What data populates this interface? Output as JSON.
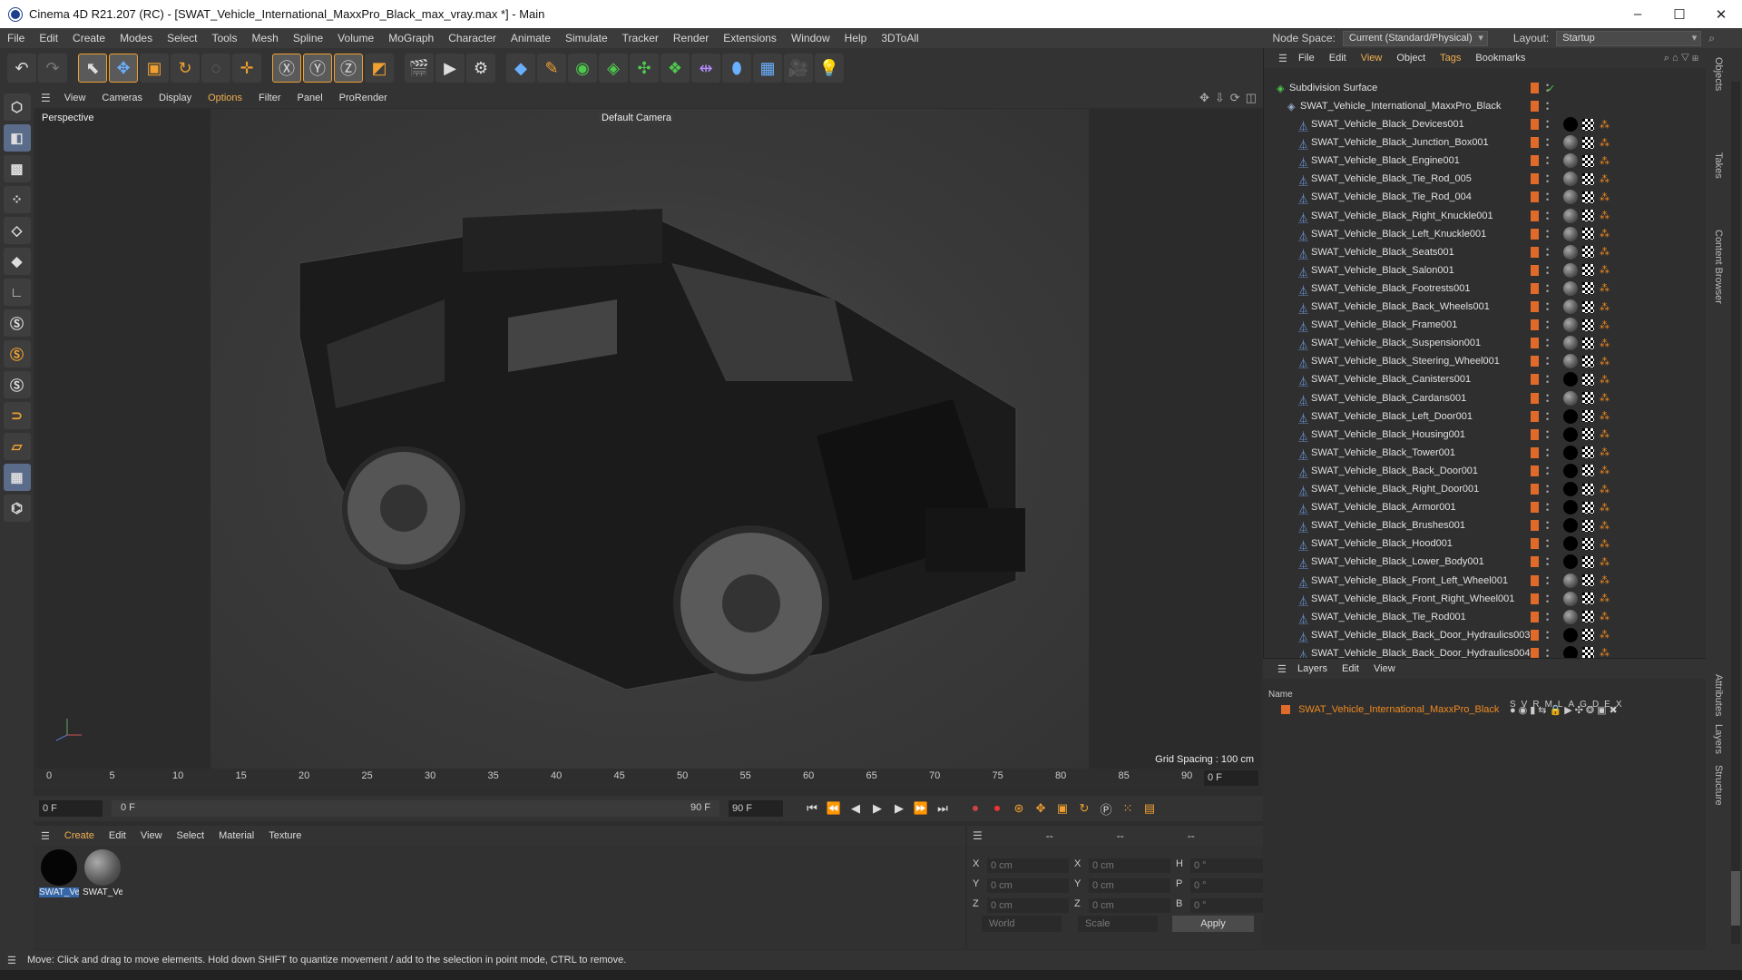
{
  "window": {
    "title": "Cinema 4D R21.207 (RC) - [SWAT_Vehicle_International_MaxxPro_Black_max_vray.max *] - Main",
    "min": "–",
    "max": "☐",
    "close": "✕"
  },
  "menu": [
    "File",
    "Edit",
    "Create",
    "Modes",
    "Select",
    "Tools",
    "Mesh",
    "Spline",
    "Volume",
    "MoGraph",
    "Character",
    "Animate",
    "Simulate",
    "Tracker",
    "Render",
    "Extensions",
    "Window",
    "Help",
    "3DToAll"
  ],
  "node_space": {
    "label": "Node Space:",
    "value": "Current (Standard/Physical)"
  },
  "layout": {
    "label": "Layout:",
    "value": "Startup"
  },
  "viewport": {
    "menu": [
      "View",
      "Cameras",
      "Display",
      "Options",
      "Filter",
      "Panel",
      "ProRender"
    ],
    "highlight_index": 3,
    "label": "Perspective",
    "camera": "Default Camera",
    "grid_spacing": "Grid Spacing : 100 cm"
  },
  "timeline": {
    "ticks": [
      "0",
      "5",
      "10",
      "15",
      "20",
      "25",
      "30",
      "35",
      "40",
      "45",
      "50",
      "55",
      "60",
      "65",
      "70",
      "75",
      "80",
      "85",
      "90"
    ],
    "current_frame": "0 F",
    "start": "0 F",
    "range_start": "0 F",
    "range_end": "90 F",
    "end": "90 F"
  },
  "materials": {
    "menu": [
      "Create",
      "Edit",
      "View",
      "Select",
      "Material",
      "Texture"
    ],
    "items": [
      {
        "label": "SWAT_Ve"
      },
      {
        "label": "SWAT_Ve"
      }
    ]
  },
  "coords": {
    "rows": [
      {
        "a": "X",
        "av": "0 cm",
        "b": "X",
        "bv": "0 cm",
        "c": "H",
        "cv": "0 °"
      },
      {
        "a": "Y",
        "av": "0 cm",
        "b": "Y",
        "bv": "0 cm",
        "c": "P",
        "cv": "0 °"
      },
      {
        "a": "Z",
        "av": "0 cm",
        "b": "Z",
        "bv": "0 cm",
        "c": "B",
        "cv": "0 °"
      }
    ],
    "world": "World",
    "scale": "Scale",
    "apply": "Apply",
    "dashes": [
      "--",
      "--",
      "--"
    ]
  },
  "status": "Move: Click and drag to move elements. Hold down SHIFT to quantize movement / add to the selection in point mode, CTRL to remove.",
  "objects": {
    "menu": [
      "File",
      "Edit",
      "View",
      "Object",
      "Tags",
      "Bookmarks"
    ],
    "root": "Subdivision Surface",
    "group": "SWAT_Vehicle_International_MaxxPro_Black",
    "items": [
      {
        "name": "SWAT_Vehicle_Black_Devices001",
        "black": true
      },
      {
        "name": "SWAT_Vehicle_Black_Junction_Box001",
        "black": false
      },
      {
        "name": "SWAT_Vehicle_Black_Engine001",
        "black": false
      },
      {
        "name": "SWAT_Vehicle_Black_Tie_Rod_005",
        "black": false
      },
      {
        "name": "SWAT_Vehicle_Black_Tie_Rod_004",
        "black": false
      },
      {
        "name": "SWAT_Vehicle_Black_Right_Knuckle001",
        "black": false
      },
      {
        "name": "SWAT_Vehicle_Black_Left_Knuckle001",
        "black": false
      },
      {
        "name": "SWAT_Vehicle_Black_Seats001",
        "black": false
      },
      {
        "name": "SWAT_Vehicle_Black_Salon001",
        "black": false
      },
      {
        "name": "SWAT_Vehicle_Black_Footrests001",
        "black": false
      },
      {
        "name": "SWAT_Vehicle_Black_Back_Wheels001",
        "black": false
      },
      {
        "name": "SWAT_Vehicle_Black_Frame001",
        "black": false
      },
      {
        "name": "SWAT_Vehicle_Black_Suspension001",
        "black": false
      },
      {
        "name": "SWAT_Vehicle_Black_Steering_Wheel001",
        "black": false
      },
      {
        "name": "SWAT_Vehicle_Black_Canisters001",
        "black": true
      },
      {
        "name": "SWAT_Vehicle_Black_Cardans001",
        "black": false
      },
      {
        "name": "SWAT_Vehicle_Black_Left_Door001",
        "black": true
      },
      {
        "name": "SWAT_Vehicle_Black_Housing001",
        "black": true
      },
      {
        "name": "SWAT_Vehicle_Black_Tower001",
        "black": true
      },
      {
        "name": "SWAT_Vehicle_Black_Back_Door001",
        "black": true
      },
      {
        "name": "SWAT_Vehicle_Black_Right_Door001",
        "black": true
      },
      {
        "name": "SWAT_Vehicle_Black_Armor001",
        "black": true
      },
      {
        "name": "SWAT_Vehicle_Black_Brushes001",
        "black": true
      },
      {
        "name": "SWAT_Vehicle_Black_Hood001",
        "black": true
      },
      {
        "name": "SWAT_Vehicle_Black_Lower_Body001",
        "black": true
      },
      {
        "name": "SWAT_Vehicle_Black_Front_Left_Wheel001",
        "black": false
      },
      {
        "name": "SWAT_Vehicle_Black_Front_Right_Wheel001",
        "black": false
      },
      {
        "name": "SWAT_Vehicle_Black_Tie_Rod001",
        "black": false
      },
      {
        "name": "SWAT_Vehicle_Black_Back_Door_Hydraulics003",
        "black": true
      },
      {
        "name": "SWAT_Vehicle_Black_Back_Door_Hydraulics004",
        "black": true
      }
    ]
  },
  "layers": {
    "menu": [
      "Layers",
      "Edit",
      "View"
    ],
    "col_name": "Name",
    "cols": [
      "S",
      "V",
      "R",
      "M",
      "L",
      "A",
      "G",
      "D",
      "E",
      "X"
    ],
    "row": "SWAT_Vehicle_International_MaxxPro_Black"
  },
  "right_tabs": [
    "Objects",
    "Takes",
    "Content Browser",
    "Attributes",
    "Layers",
    "Structure"
  ],
  "colors": {
    "accent": "#f0a030",
    "tag": "#e06a2a",
    "select": "#3566a8"
  }
}
